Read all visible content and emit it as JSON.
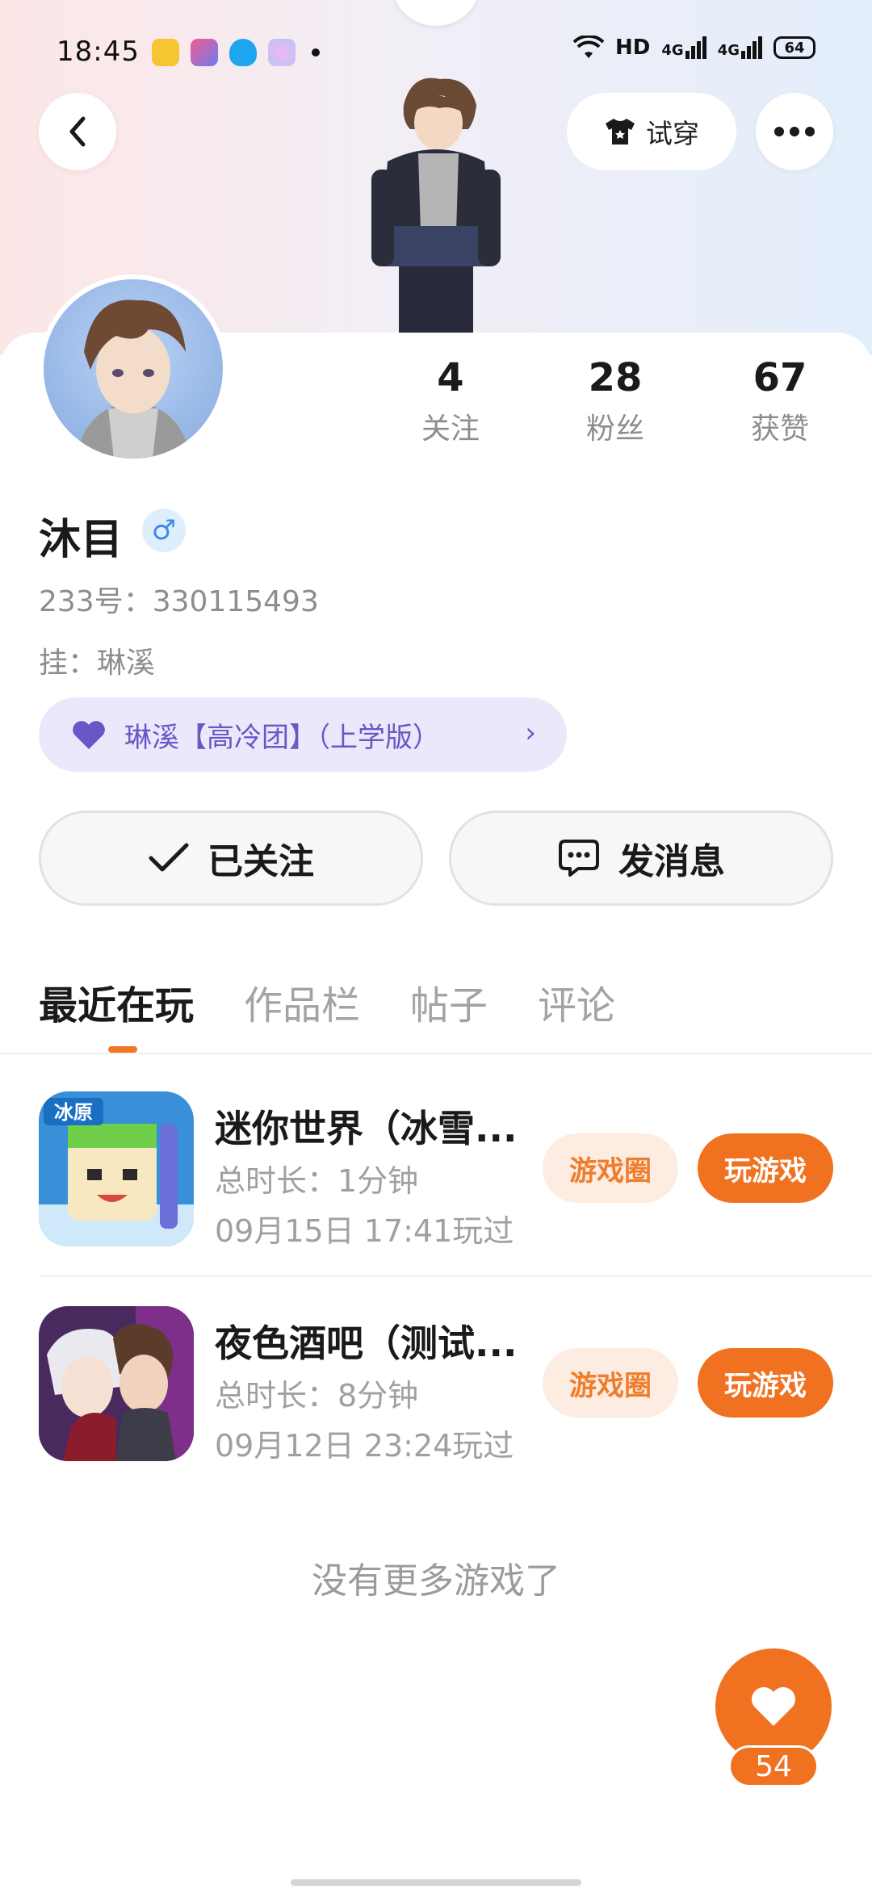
{
  "status_bar": {
    "time": "18:45",
    "network": "HD",
    "signal_1": "4G",
    "signal_2": "4G",
    "battery": "64"
  },
  "header": {
    "try_on_label": "试穿"
  },
  "profile": {
    "name": "沐目",
    "gender_symbol": "♂",
    "uid": "233号：330115493",
    "hang": "挂：琳溪",
    "group_label": "琳溪【高冷团】（上学版）",
    "stats": [
      {
        "value": "4",
        "label": "关注"
      },
      {
        "value": "28",
        "label": "粉丝"
      },
      {
        "value": "67",
        "label": "获赞"
      }
    ]
  },
  "actions": {
    "followed_label": "已关注",
    "message_label": "发消息"
  },
  "tabs": [
    {
      "label": "最近在玩",
      "active": true
    },
    {
      "label": "作品栏",
      "active": false
    },
    {
      "label": "帖子",
      "active": false
    },
    {
      "label": "评论",
      "active": false
    }
  ],
  "games": [
    {
      "title": "迷你世界（冰雪...",
      "duration": "总时长：1分钟",
      "last_played": "09月15日 17:41玩过",
      "icon_badge": "冰原",
      "circle_label": "游戏圈",
      "play_label": "玩游戏"
    },
    {
      "title": "夜色酒吧（测试...",
      "duration": "总时长：8分钟",
      "last_played": "09月12日 23:24玩过",
      "circle_label": "游戏圈",
      "play_label": "玩游戏"
    }
  ],
  "footer": {
    "no_more": "没有更多游戏了",
    "like_count": "54"
  },
  "colors": {
    "accent": "#f07221",
    "pill_purple_bg": "#ece8fb",
    "pill_purple_text": "#6a56c6"
  }
}
